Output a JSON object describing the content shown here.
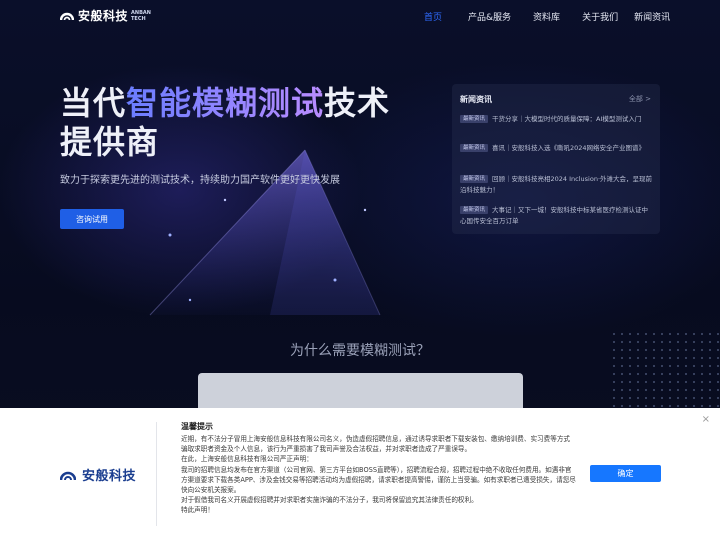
{
  "brand": {
    "name": "安般科技",
    "sub_line1": "ANBAN",
    "sub_line2": "TECH"
  },
  "nav": {
    "items": [
      {
        "label": "首页",
        "active": true
      },
      {
        "label": "产品&服务",
        "active": false
      },
      {
        "label": "资料库",
        "active": false
      },
      {
        "label": "关于我们",
        "active": false
      },
      {
        "label": "新闻资讯",
        "active": false
      }
    ]
  },
  "hero": {
    "headline_part1": "当代",
    "headline_highlight": "智能模糊测试",
    "headline_part2": "技术",
    "headline_line2": "提供商",
    "tagline": "致力于探索更先进的测试技术，持续助力国产软件更好更快发展",
    "cta_label": "咨询试用"
  },
  "news": {
    "title": "新闻资讯",
    "all_label": "全部 >",
    "items": [
      {
        "badge": "最新资讯",
        "text": "干货分享｜大模型时代的质量保障：AI模型测试入门"
      },
      {
        "badge": "最新资讯",
        "text": "喜讯｜安般科技入选《嘶吼2024网络安全产业图谱》"
      },
      {
        "badge": "最新资讯",
        "text": "回顾｜安般科技亮相2024 Inclusion·外滩大会，呈现前沿科技魅力！"
      },
      {
        "badge": "最新资讯",
        "text": "大事记｜又下一城！安般科技中标某省医疗检测认证中心国传安全百万订单"
      }
    ]
  },
  "why": {
    "title": "为什么需要模糊测试？"
  },
  "notice": {
    "brand_name": "安般科技",
    "title": "温馨提示",
    "paragraphs": [
      "近期，有不法分子冒用上海安般信息科技有限公司名义，伪造虚假招聘信息，通过诱导求职者下载安装包、缴纳培训费、实习费等方式骗取求职者资金及个人信息，该行为严重损害了我司声誉及合法权益，并对求职者造成了严重误导。",
      "在此，上海安般信息科技有限公司严正声明：",
      "我司的招聘信息均发布在官方渠道（公司官网、第三方平台如BOSS直聘等），招聘流程合规，招聘过程中绝不收取任何费用。如遇非官方渠道要求下载各类APP、涉及金钱交易等招聘活动均为虚假招聘，请求职者提高警惕，谨防上当受骗。如有求职者已遭受损失，请您尽快向公安机关报案。",
      "对于假借我司名义开展虚假招聘并对求职者实施诈骗的不法分子，我司将保留追究其法律责任的权利。",
      "特此声明！"
    ],
    "ok_label": "确定",
    "close_glyph": "×"
  },
  "colors": {
    "accent": "#1f5fe6",
    "nav_active": "#2f6bff",
    "notice_button": "#1677ff",
    "brand_dark": "#1a3d8f"
  },
  "icons": {
    "logo": "anban-logo-icon",
    "close": "close-icon"
  }
}
